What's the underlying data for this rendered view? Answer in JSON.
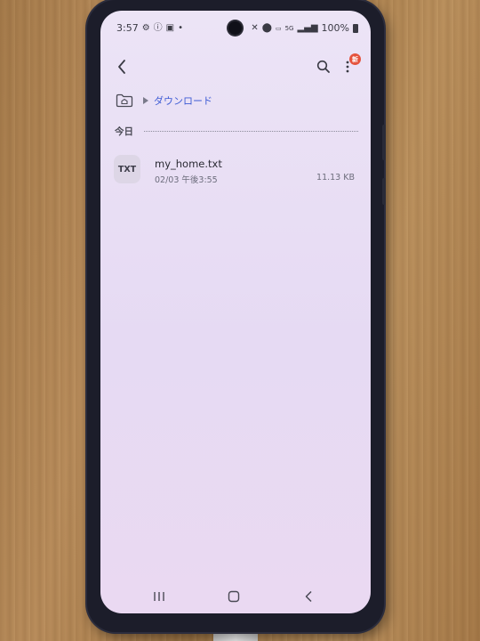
{
  "status_bar": {
    "time": "3:57",
    "battery": "100%",
    "left_icons": [
      "settings-gear-icon",
      "info-circle-icon",
      "sim-card-icon",
      "dot-icon"
    ],
    "right_icons": [
      "mute-icon",
      "location-icon",
      "volte-icon",
      "5g-icon",
      "signal-icon",
      "battery-icon"
    ]
  },
  "app_bar": {
    "back_icon": "chevron-left-icon",
    "search_icon": "search-icon",
    "more_icon": "more-vertical-icon",
    "new_badge": "新"
  },
  "breadcrumb": {
    "home_icon": "home-folder-icon",
    "current": "ダウンロード"
  },
  "section": {
    "label": "今日"
  },
  "files": [
    {
      "type_label": "TXT",
      "name": "my_home.txt",
      "date": "02/03 午後3:55",
      "size": "11.13 KB"
    }
  ],
  "nav_bar": {
    "items": [
      "recent-apps-icon",
      "home-icon",
      "back-icon"
    ]
  },
  "colors": {
    "accent": "#3d5bd4",
    "badge": "#e5533d",
    "screen_bg": "#e9dff5"
  }
}
